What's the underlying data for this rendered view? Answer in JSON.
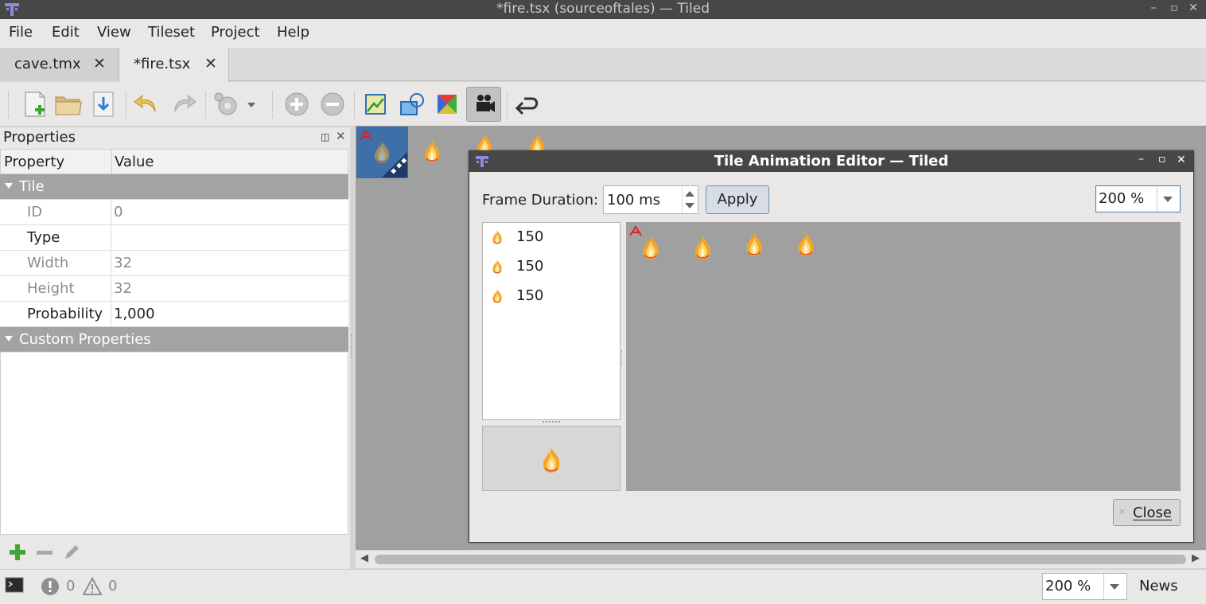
{
  "window": {
    "title": "*fire.tsx (sourceoftales) — Tiled"
  },
  "menu": [
    "File",
    "Edit",
    "View",
    "Tileset",
    "Project",
    "Help"
  ],
  "tabs": [
    {
      "label": "cave.tmx"
    },
    {
      "label": "*fire.tsx"
    }
  ],
  "toolbar": {
    "icons": [
      "new-file-icon",
      "open-folder-icon",
      "save-icon",
      "undo-icon",
      "redo-icon",
      "settings-icon",
      "add-tiles-icon",
      "remove-tiles-icon",
      "terrain-icon",
      "collision-icon",
      "wang-color-icon",
      "animation-editor-icon",
      "back-arrow-icon"
    ]
  },
  "properties": {
    "title": "Properties",
    "col_property": "Property",
    "col_value": "Value",
    "group_tile": "Tile",
    "rows": [
      {
        "key": "ID",
        "value": "0"
      },
      {
        "key": "Type",
        "value": ""
      },
      {
        "key": "Width",
        "value": "32"
      },
      {
        "key": "Height",
        "value": "32"
      },
      {
        "key": "Probability",
        "value": "1,000"
      }
    ],
    "group_custom": "Custom Properties"
  },
  "status": {
    "errors": "0",
    "warnings": "0",
    "zoom": "200 %",
    "news": "News"
  },
  "dialog": {
    "title": "Tile Animation Editor — Tiled",
    "frame_duration_label": "Frame Duration:",
    "frame_duration_value": "100 ms",
    "apply": "Apply",
    "zoom": "200 %",
    "frames": [
      {
        "duration": "150"
      },
      {
        "duration": "150"
      },
      {
        "duration": "150"
      }
    ],
    "close": "Close"
  },
  "colors": {
    "titlebar": "#474747",
    "selection": "#3e6fa8",
    "tileset_bg": "#a0a0a0",
    "group_row": "#a3a3a3"
  }
}
